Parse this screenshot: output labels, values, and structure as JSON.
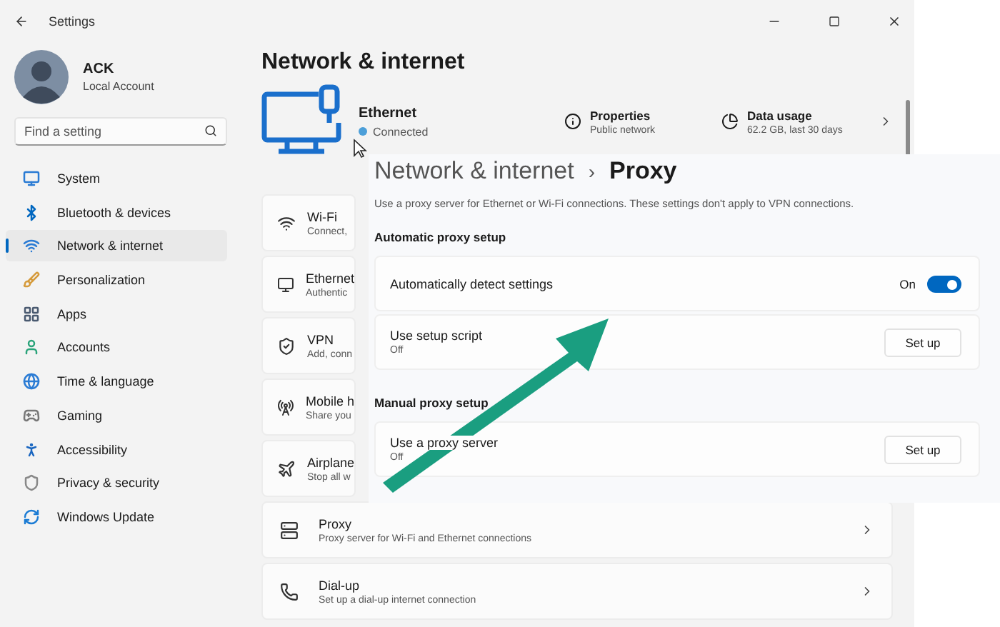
{
  "window": {
    "title": "Settings"
  },
  "account": {
    "name": "ACK",
    "type": "Local Account"
  },
  "search": {
    "placeholder": "Find a setting"
  },
  "sidebar": {
    "items": [
      {
        "kind": "system",
        "label": "System",
        "selected": false
      },
      {
        "kind": "bluetooth",
        "label": "Bluetooth & devices",
        "selected": false
      },
      {
        "kind": "network",
        "label": "Network & internet",
        "selected": true
      },
      {
        "kind": "personalization",
        "label": "Personalization",
        "selected": false
      },
      {
        "kind": "apps",
        "label": "Apps",
        "selected": false
      },
      {
        "kind": "accounts",
        "label": "Accounts",
        "selected": false
      },
      {
        "kind": "time",
        "label": "Time & language",
        "selected": false
      },
      {
        "kind": "gaming",
        "label": "Gaming",
        "selected": false
      },
      {
        "kind": "accessibility",
        "label": "Accessibility",
        "selected": false
      },
      {
        "kind": "privacy",
        "label": "Privacy & security",
        "selected": false
      },
      {
        "kind": "update",
        "label": "Windows Update",
        "selected": false
      }
    ]
  },
  "page": {
    "title": "Network & internet",
    "ethernet": {
      "name": "Ethernet",
      "status": "Connected",
      "properties": {
        "title": "Properties",
        "subtitle": "Public network"
      },
      "data_usage": {
        "title": "Data usage",
        "subtitle": "62.2 GB, last 30 days"
      }
    },
    "items": [
      {
        "kind": "wifi",
        "title": "Wi-Fi",
        "subtitle": "Connect,"
      },
      {
        "kind": "ethernet",
        "title": "Ethernet",
        "subtitle": "Authentic"
      },
      {
        "kind": "vpn",
        "title": "VPN",
        "subtitle": "Add, conn"
      },
      {
        "kind": "hotspot",
        "title": "Mobile h",
        "subtitle": "Share you"
      },
      {
        "kind": "airplane",
        "title": "Airplane",
        "subtitle": "Stop all w"
      },
      {
        "kind": "proxy",
        "title": "Proxy",
        "subtitle": "Proxy server for Wi-Fi and Ethernet connections"
      },
      {
        "kind": "dialup",
        "title": "Dial-up",
        "subtitle": "Set up a dial-up internet connection"
      }
    ]
  },
  "proxy_window": {
    "breadcrumb": {
      "parent": "Network & internet",
      "separator": "›",
      "current": "Proxy"
    },
    "description": "Use a proxy server for Ethernet or Wi-Fi connections. These settings don't apply to VPN connections.",
    "sections": [
      {
        "heading": "Automatic proxy setup",
        "rows": [
          {
            "kind": "toggle",
            "title": "Automatically detect settings",
            "state_label": "On",
            "on": true
          },
          {
            "kind": "button",
            "title": "Use setup script",
            "subtitle": "Off",
            "button": "Set up"
          }
        ]
      },
      {
        "heading": "Manual proxy setup",
        "rows": [
          {
            "kind": "button",
            "title": "Use a proxy server",
            "subtitle": "Off",
            "button": "Set up"
          }
        ]
      }
    ]
  }
}
